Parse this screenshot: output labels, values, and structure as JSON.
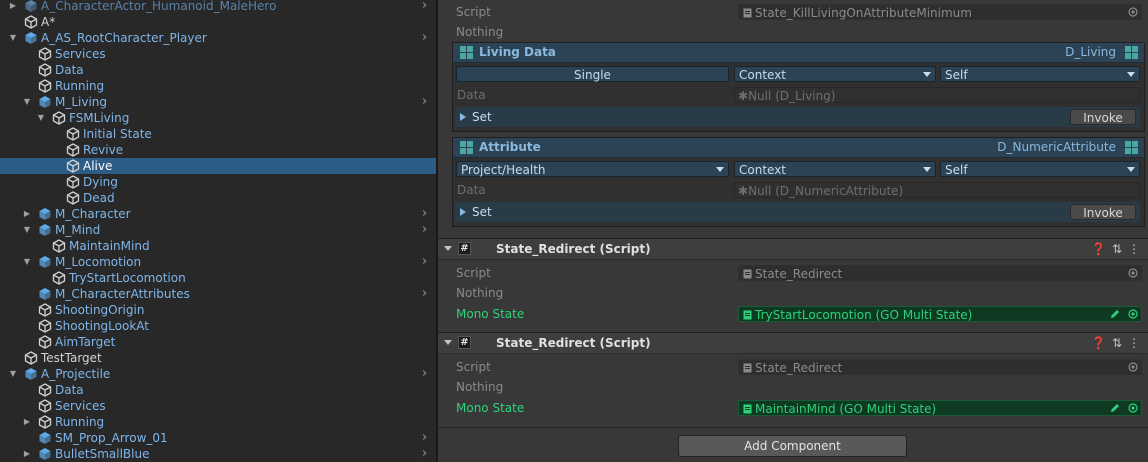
{
  "hierarchy": {
    "rows": [
      {
        "label": "A_CharacterActor_Humanoid_MaleHero",
        "depth": 0,
        "fold": "closed",
        "icon": "prefab-icon",
        "style": "dim",
        "chevron": true
      },
      {
        "label": "A*",
        "depth": 0,
        "fold": "none",
        "icon": "gameobject-icon",
        "style": "normal",
        "chevron": false
      },
      {
        "label": "A_AS_RootCharacter_Player",
        "depth": 0,
        "fold": "open",
        "icon": "prefab-icon",
        "style": "prefab",
        "chevron": true
      },
      {
        "label": "Services",
        "depth": 1,
        "fold": "none",
        "icon": "gameobject-icon",
        "style": "prefab",
        "chevron": false
      },
      {
        "label": "Data",
        "depth": 1,
        "fold": "none",
        "icon": "gameobject-icon",
        "style": "prefab",
        "chevron": false
      },
      {
        "label": "Running",
        "depth": 1,
        "fold": "none",
        "icon": "gameobject-icon",
        "style": "prefab",
        "chevron": false
      },
      {
        "label": "M_Living",
        "depth": 1,
        "fold": "open",
        "icon": "prefab-icon",
        "style": "prefab",
        "chevron": true
      },
      {
        "label": "FSMLiving",
        "depth": 2,
        "fold": "open",
        "icon": "gameobject-icon",
        "style": "prefab",
        "chevron": false
      },
      {
        "label": "Initial State",
        "depth": 3,
        "fold": "none",
        "icon": "gameobject-icon",
        "style": "prefab",
        "chevron": false
      },
      {
        "label": "Revive",
        "depth": 3,
        "fold": "none",
        "icon": "gameobject-icon",
        "style": "prefab",
        "chevron": false
      },
      {
        "label": "Alive",
        "depth": 3,
        "fold": "none",
        "icon": "gameobject-icon",
        "style": "normal",
        "chevron": false,
        "selected": true
      },
      {
        "label": "Dying",
        "depth": 3,
        "fold": "none",
        "icon": "gameobject-icon",
        "style": "prefab",
        "chevron": false
      },
      {
        "label": "Dead",
        "depth": 3,
        "fold": "none",
        "icon": "gameobject-icon",
        "style": "prefab",
        "chevron": false
      },
      {
        "label": "M_Character",
        "depth": 1,
        "fold": "closed",
        "icon": "prefab-icon",
        "style": "prefab",
        "chevron": true
      },
      {
        "label": "M_Mind",
        "depth": 1,
        "fold": "open",
        "icon": "prefab-icon",
        "style": "prefab",
        "chevron": true
      },
      {
        "label": "MaintainMind",
        "depth": 2,
        "fold": "none",
        "icon": "gameobject-icon",
        "style": "prefab",
        "chevron": false
      },
      {
        "label": "M_Locomotion",
        "depth": 1,
        "fold": "open",
        "icon": "prefab-icon",
        "style": "prefab",
        "chevron": true
      },
      {
        "label": "TryStartLocomotion",
        "depth": 2,
        "fold": "none",
        "icon": "gameobject-icon",
        "style": "prefab",
        "chevron": false
      },
      {
        "label": "M_CharacterAttributes",
        "depth": 1,
        "fold": "none",
        "icon": "prefab-icon",
        "style": "prefab",
        "chevron": true
      },
      {
        "label": "ShootingOrigin",
        "depth": 1,
        "fold": "none",
        "icon": "gameobject-icon",
        "style": "prefab",
        "chevron": false
      },
      {
        "label": "ShootingLookAt",
        "depth": 1,
        "fold": "none",
        "icon": "gameobject-icon",
        "style": "prefab",
        "chevron": false
      },
      {
        "label": "AimTarget",
        "depth": 1,
        "fold": "none",
        "icon": "gameobject-icon",
        "style": "prefab",
        "chevron": false
      },
      {
        "label": "TestTarget",
        "depth": 0,
        "fold": "none",
        "icon": "gameobject-icon",
        "style": "normal",
        "chevron": false
      },
      {
        "label": "A_Projectile",
        "depth": 0,
        "fold": "open",
        "icon": "prefab-icon",
        "style": "prefab",
        "chevron": true
      },
      {
        "label": "Data",
        "depth": 1,
        "fold": "none",
        "icon": "gameobject-icon",
        "style": "prefab",
        "chevron": false
      },
      {
        "label": "Services",
        "depth": 1,
        "fold": "none",
        "icon": "gameobject-icon",
        "style": "prefab",
        "chevron": false
      },
      {
        "label": "Running",
        "depth": 1,
        "fold": "closed",
        "icon": "gameobject-icon",
        "style": "prefab",
        "chevron": false
      },
      {
        "label": "SM_Prop_Arrow_01",
        "depth": 1,
        "fold": "none",
        "icon": "prefab-icon",
        "style": "prefab",
        "chevron": true
      },
      {
        "label": "BulletSmallBlue",
        "depth": 1,
        "fold": "closed",
        "icon": "prefab-icon",
        "style": "prefab",
        "chevron": true
      }
    ]
  },
  "inspector": {
    "top": {
      "script_label": "Script",
      "script_value": "State_KillLivingOnAttributeMinimum",
      "nothing_label": "Nothing"
    },
    "living_data": {
      "title": "Living Data",
      "type": "D_Living",
      "mode": "Single",
      "source": "Context",
      "target": "Self",
      "data_label": "Data",
      "data_value": "Null (D_Living)",
      "set_label": "Set",
      "invoke_label": "Invoke"
    },
    "attribute": {
      "title": "Attribute",
      "type": "D_NumericAttribute",
      "mode": "Project/Health",
      "source": "Context",
      "target": "Self",
      "data_label": "Data",
      "data_value": "Null (D_NumericAttribute)",
      "set_label": "Set",
      "invoke_label": "Invoke"
    },
    "components": [
      {
        "title": "State_Redirect (Script)",
        "script_label": "Script",
        "script_value": "State_Redirect",
        "nothing_label": "Nothing",
        "mono_label": "Mono State",
        "mono_value": "TryStartLocomotion (GO Multi State)"
      },
      {
        "title": "State_Redirect (Script)",
        "script_label": "Script",
        "script_value": "State_Redirect",
        "nothing_label": "Nothing",
        "mono_label": "Mono State",
        "mono_value": "MaintainMind (GO Multi State)"
      }
    ],
    "add_component_label": "Add Component"
  },
  "colors": {
    "selection": "#2c5d87",
    "prefab_text": "#7fb5ea",
    "mono_state_green": "#2ed27a",
    "panel_header": "#2b4355"
  }
}
